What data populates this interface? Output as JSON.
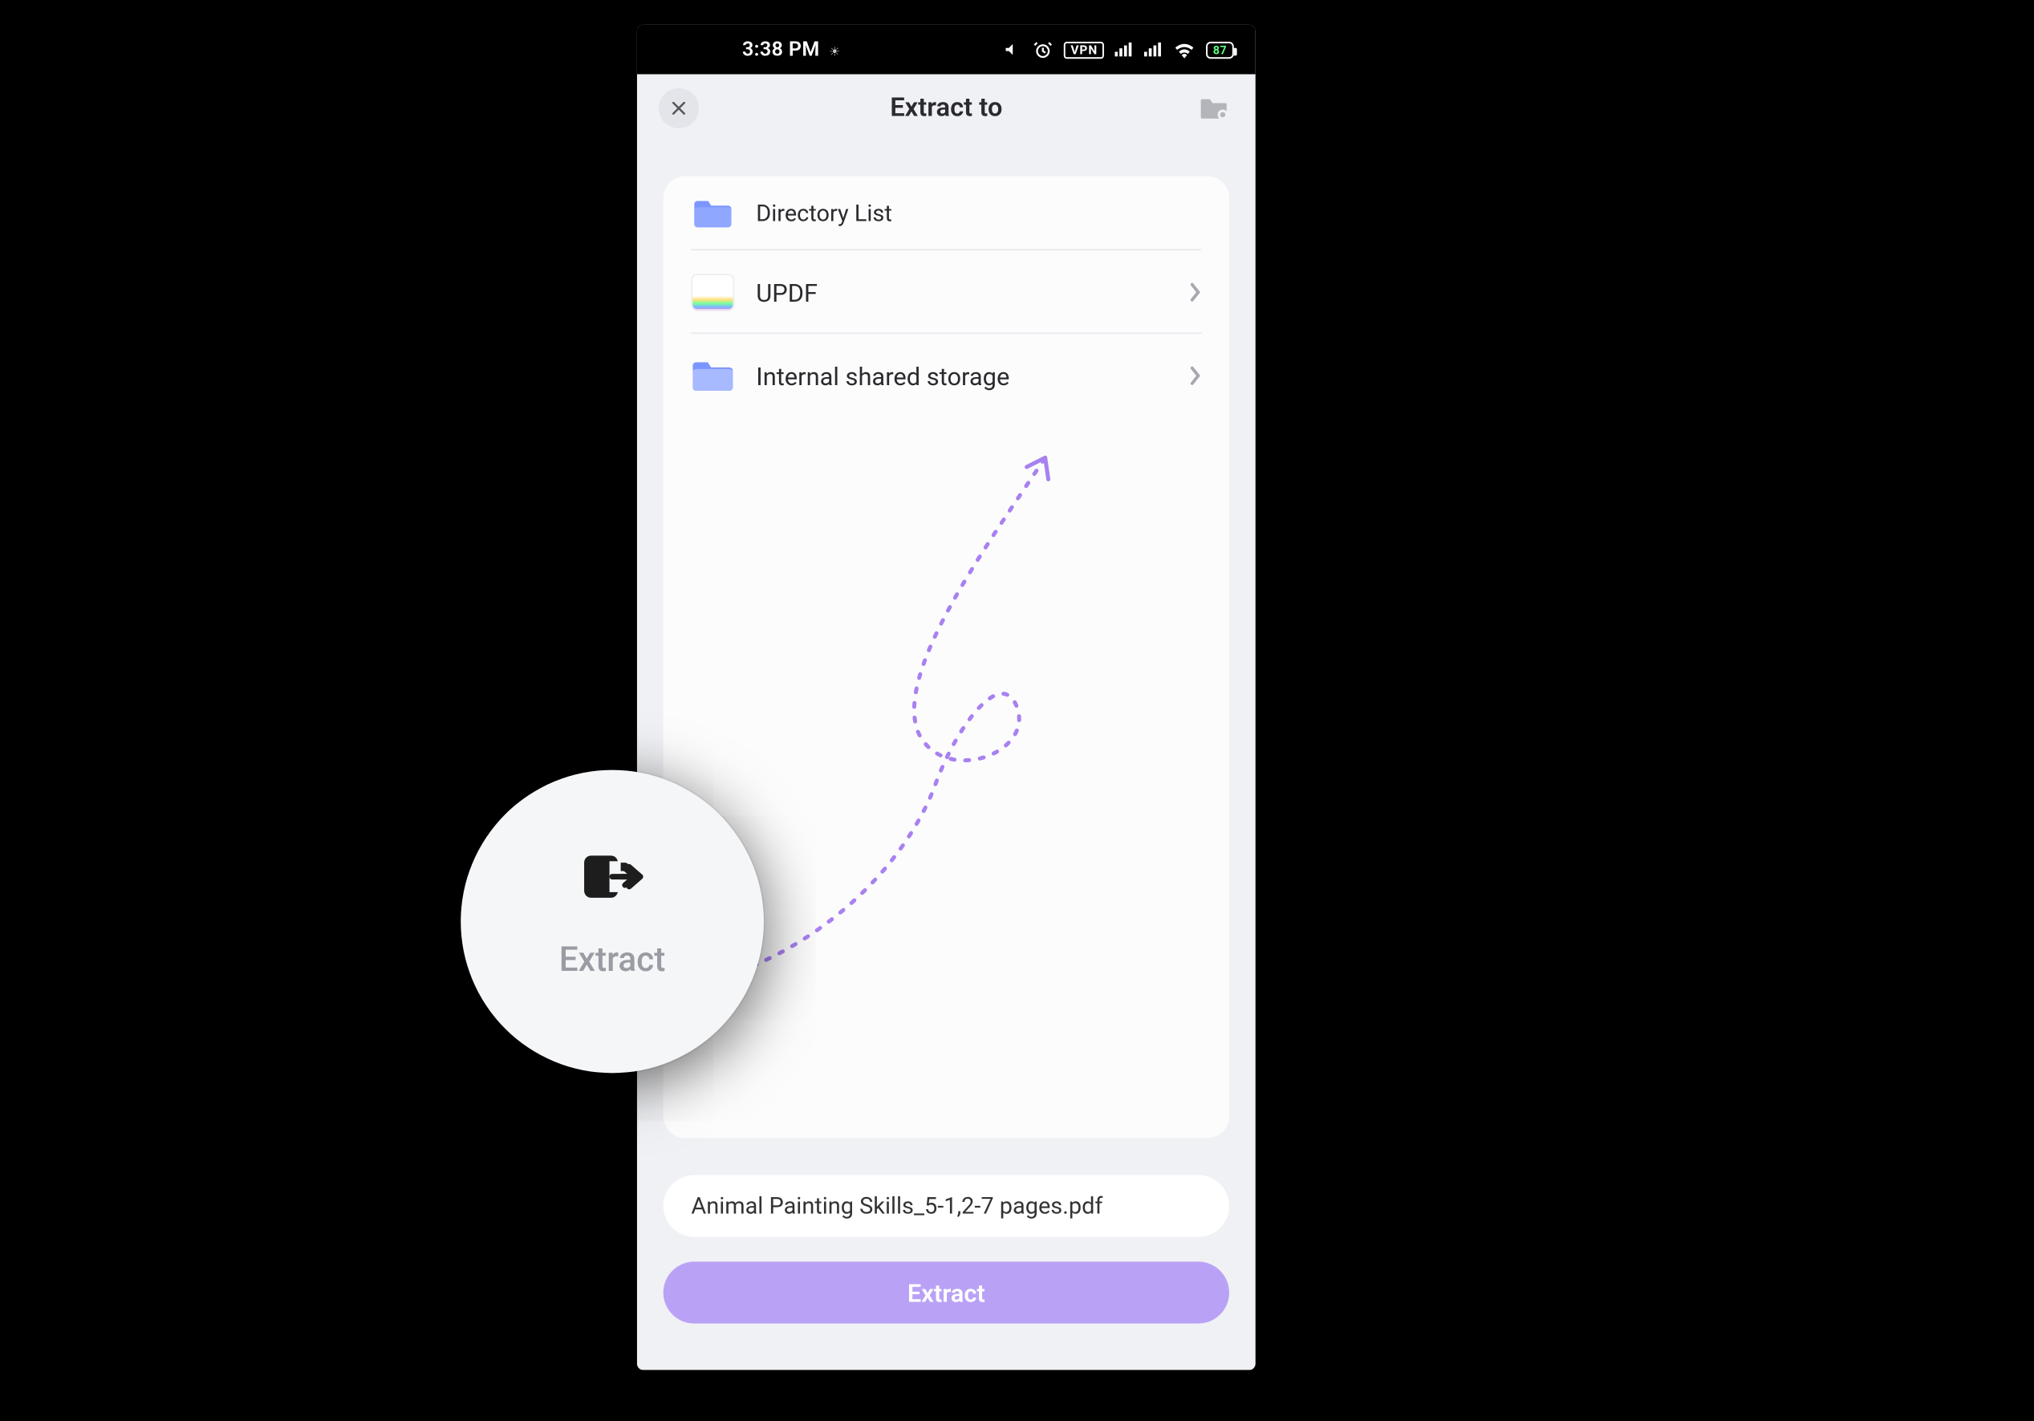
{
  "status": {
    "time": "3:38 PM",
    "icons": {
      "silent": "silent-icon",
      "alarm": "alarm-icon",
      "vpn_label": "VPN",
      "signal1": "signal-icon",
      "signal2": "signal-icon",
      "wifi": "wifi-icon",
      "battery_pct": "87"
    }
  },
  "header": {
    "title": "Extract to"
  },
  "list": {
    "section_label": "Directory List",
    "items": [
      {
        "label": "UPDF",
        "kind": "app"
      },
      {
        "label": "Internal shared storage",
        "kind": "folder"
      }
    ]
  },
  "filename": {
    "value": "Animal Painting Skills_5-1,2-7 pages.pdf"
  },
  "primary_button": {
    "label": "Extract"
  },
  "callout": {
    "label": "Extract"
  }
}
